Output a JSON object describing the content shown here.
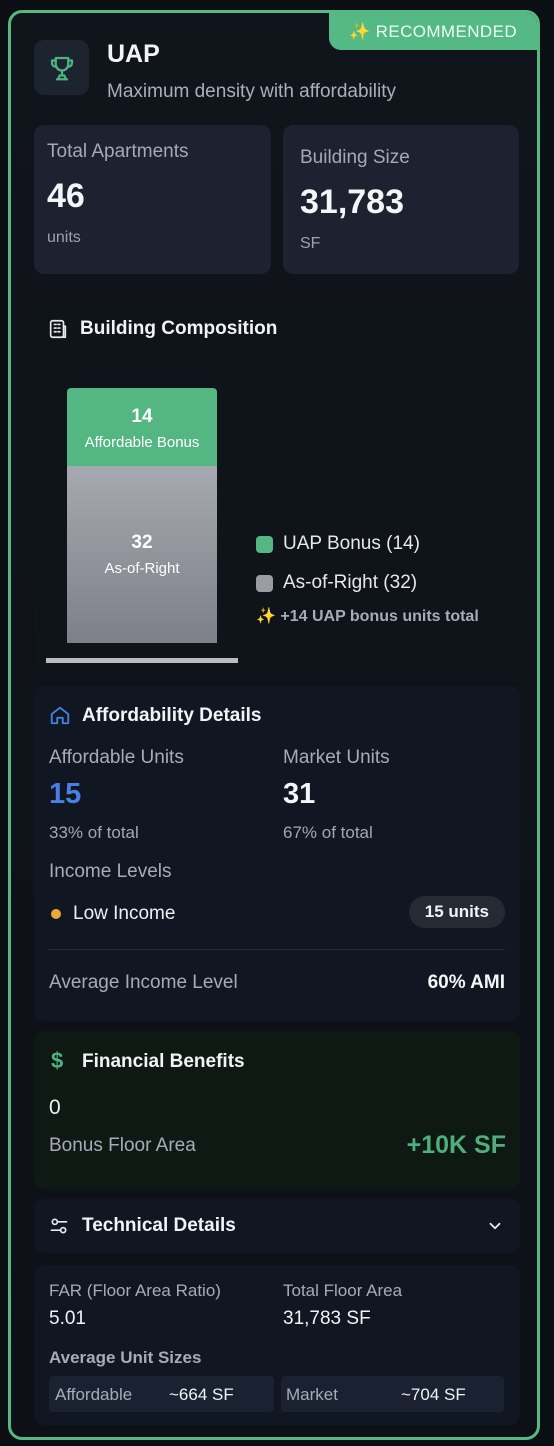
{
  "badge": {
    "icon": "sparkles-icon",
    "label": "✨ RECOMMENDED"
  },
  "header": {
    "icon": "trophy-icon",
    "title": "UAP",
    "subtitle": "Maximum density with affordability"
  },
  "stats": [
    {
      "label": "Total Apartments",
      "value": "46",
      "unit": "units"
    },
    {
      "label": "Building Size",
      "value": "31,783",
      "unit": "SF"
    }
  ],
  "composition": {
    "icon": "building-icon",
    "title": "Building Composition",
    "bonus": {
      "count": "14",
      "label": "Affordable Bonus"
    },
    "base": {
      "count": "32",
      "label": "As-of-Right"
    },
    "legend": [
      "UAP Bonus (14)",
      "As-of-Right (32)"
    ],
    "note": "✨ +14 UAP bonus units total"
  },
  "chart_data": {
    "type": "bar",
    "stacked": true,
    "categories": [
      ""
    ],
    "series": [
      {
        "name": "UAP Bonus (14)",
        "values": [
          14
        ],
        "color": "#53b683"
      },
      {
        "name": "As-of-Right (32)",
        "values": [
          32
        ],
        "color": "#9a9ca4"
      }
    ]
  },
  "affordability": {
    "icon": "home-icon",
    "title": "Affordability Details",
    "affordable": {
      "label": "Affordable Units",
      "value": "15",
      "sub": "33% of total"
    },
    "market": {
      "label": "Market Units",
      "value": "31",
      "sub": "67% of total"
    },
    "income_levels_label": "Income Levels",
    "income": {
      "name": "Low Income",
      "units": "15 units"
    },
    "avg_label": "Average Income Level",
    "avg_value": "60% AMI"
  },
  "financial": {
    "icon": "dollar-icon",
    "title": "Financial Benefits",
    "value": "0",
    "label": "Bonus Floor Area",
    "amount": "+10K SF"
  },
  "technical": {
    "icon": "sliders-icon",
    "title": "Technical Details",
    "far_label": "FAR (Floor Area Ratio)",
    "far_value": "5.01",
    "total_label": "Total Floor Area",
    "total_value": "31,783 SF",
    "avg_sizes_label": "Average Unit Sizes",
    "affordable_label": "Affordable",
    "affordable_value": "~664 SF",
    "market_label": "Market",
    "market_value": "~704 SF"
  },
  "colors": {
    "accent": "#55b985",
    "blue": "#4a7fe6",
    "orange": "#f0a83a"
  }
}
